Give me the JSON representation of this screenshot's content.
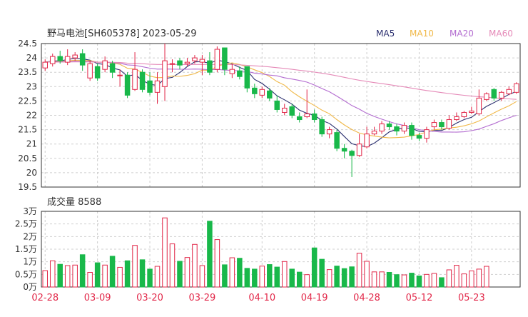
{
  "header": {
    "title": "野马电池[SH605378] 2023-05-29",
    "ma_legend": [
      {
        "label": "MA5",
        "color": "#2b2f6f"
      },
      {
        "label": "MA10",
        "color": "#f0b848"
      },
      {
        "label": "MA20",
        "color": "#b36cd0"
      },
      {
        "label": "MA60",
        "color": "#e58ab8"
      }
    ]
  },
  "colors": {
    "up": "#e2294a",
    "down": "#19b84a",
    "grid": "#cfcfcf",
    "axis": "#333333"
  },
  "chart_data": [
    {
      "type": "candlestick",
      "ylim": [
        19.5,
        24.5
      ],
      "yticks": [
        "24.5",
        "24",
        "23.5",
        "23",
        "22.5",
        "22",
        "21.5",
        "21",
        "20.5",
        "20",
        "19.5"
      ],
      "xticks": [
        {
          "index": 0,
          "label": "02-28"
        },
        {
          "index": 7,
          "label": "03-09"
        },
        {
          "index": 14,
          "label": "03-20"
        },
        {
          "index": 21,
          "label": "03-29"
        },
        {
          "index": 29,
          "label": "04-10"
        },
        {
          "index": 36,
          "label": "04-19"
        },
        {
          "index": 43,
          "label": "04-28"
        },
        {
          "index": 50,
          "label": "05-12"
        },
        {
          "index": 57,
          "label": "05-23"
        }
      ],
      "candles": [
        [
          23.65,
          23.85,
          23.55,
          23.95
        ],
        [
          23.8,
          24.05,
          23.7,
          24.15
        ],
        [
          24.05,
          23.9,
          23.8,
          24.25
        ],
        [
          23.85,
          24.05,
          23.75,
          24.3
        ],
        [
          24.0,
          24.1,
          23.9,
          24.2
        ],
        [
          24.15,
          23.75,
          23.55,
          24.3
        ],
        [
          23.3,
          23.8,
          23.2,
          23.9
        ],
        [
          23.7,
          23.3,
          23.2,
          23.8
        ],
        [
          23.6,
          23.9,
          23.5,
          24.05
        ],
        [
          23.8,
          23.5,
          23.3,
          23.9
        ],
        [
          23.4,
          23.4,
          23.0,
          23.6
        ],
        [
          23.4,
          22.7,
          22.6,
          23.5
        ],
        [
          22.9,
          23.6,
          22.85,
          24.2
        ],
        [
          23.5,
          22.9,
          22.8,
          23.6
        ],
        [
          23.2,
          22.8,
          22.7,
          23.5
        ],
        [
          22.8,
          23.2,
          22.4,
          23.5
        ],
        [
          23.0,
          23.9,
          22.5,
          24.5
        ],
        [
          23.8,
          23.8,
          23.5,
          23.95
        ],
        [
          23.9,
          23.75,
          23.6,
          24.0
        ],
        [
          23.8,
          23.85,
          23.7,
          24.0
        ],
        [
          23.9,
          24.0,
          23.8,
          24.1
        ],
        [
          23.85,
          23.95,
          23.4,
          24.1
        ],
        [
          23.9,
          23.5,
          23.4,
          24.2
        ],
        [
          23.6,
          24.3,
          23.5,
          24.4
        ],
        [
          24.35,
          23.6,
          23.4,
          24.35
        ],
        [
          23.45,
          23.6,
          23.3,
          23.8
        ],
        [
          23.55,
          23.35,
          23.25,
          23.7
        ],
        [
          23.7,
          22.95,
          22.8,
          23.7
        ],
        [
          22.95,
          22.75,
          22.6,
          23.1
        ],
        [
          22.7,
          22.9,
          22.6,
          23.0
        ],
        [
          22.85,
          22.6,
          22.5,
          22.95
        ],
        [
          22.5,
          22.2,
          22.1,
          22.7
        ],
        [
          22.1,
          22.25,
          22.0,
          22.4
        ],
        [
          22.3,
          22.0,
          21.9,
          22.4
        ],
        [
          21.95,
          21.85,
          21.75,
          22.1
        ],
        [
          21.95,
          22.05,
          21.9,
          22.9
        ],
        [
          22.05,
          21.85,
          21.75,
          22.2
        ],
        [
          21.85,
          21.35,
          21.25,
          21.95
        ],
        [
          21.35,
          21.5,
          21.2,
          21.6
        ],
        [
          21.4,
          20.85,
          20.75,
          21.5
        ],
        [
          20.85,
          20.75,
          20.5,
          21.0
        ],
        [
          20.75,
          20.6,
          19.85,
          20.8
        ],
        [
          20.6,
          21.0,
          20.55,
          21.35
        ],
        [
          20.9,
          21.35,
          20.85,
          21.6
        ],
        [
          21.35,
          21.45,
          21.3,
          21.6
        ],
        [
          21.45,
          21.7,
          21.35,
          21.8
        ],
        [
          21.7,
          21.6,
          21.5,
          21.8
        ],
        [
          21.6,
          21.45,
          21.3,
          21.7
        ],
        [
          21.45,
          21.65,
          21.35,
          21.75
        ],
        [
          21.65,
          21.3,
          21.15,
          21.75
        ],
        [
          21.3,
          21.2,
          21.1,
          21.4
        ],
        [
          21.2,
          21.5,
          21.05,
          21.6
        ],
        [
          21.6,
          21.75,
          21.5,
          21.85
        ],
        [
          21.75,
          21.6,
          21.5,
          21.85
        ],
        [
          21.55,
          21.85,
          21.5,
          22.0
        ],
        [
          21.85,
          21.95,
          21.8,
          22.1
        ],
        [
          21.95,
          22.1,
          21.9,
          22.15
        ],
        [
          22.1,
          22.15,
          22.05,
          22.3
        ],
        [
          22.05,
          22.6,
          22.0,
          22.9
        ],
        [
          22.55,
          22.75,
          22.5,
          22.8
        ],
        [
          22.9,
          22.6,
          22.5,
          22.95
        ],
        [
          22.6,
          22.8,
          22.5,
          22.85
        ],
        [
          22.75,
          22.9,
          22.7,
          23.0
        ],
        [
          22.8,
          23.1,
          22.75,
          23.15
        ]
      ]
    },
    {
      "type": "bar",
      "title": "成交量 8588",
      "ylim": [
        0,
        30000
      ],
      "yticks": [
        {
          "value": 30000,
          "label": "3万"
        },
        {
          "value": 25000,
          "label": "2.5万"
        },
        {
          "value": 20000,
          "label": "2万"
        },
        {
          "value": 15000,
          "label": "1.5万"
        },
        {
          "value": 10000,
          "label": "1万"
        },
        {
          "value": 5000,
          "label": "0.5万"
        },
        {
          "value": 0,
          "label": "0万"
        }
      ],
      "values": [
        6500,
        10400,
        9000,
        8500,
        8700,
        12800,
        5800,
        9600,
        8700,
        12200,
        7800,
        10400,
        16500,
        10800,
        7100,
        8200,
        27400,
        17100,
        10200,
        11700,
        16900,
        8500,
        26100,
        18800,
        8800,
        11600,
        11400,
        7400,
        7100,
        8300,
        8900,
        7900,
        10100,
        7100,
        5900,
        4900,
        15500,
        11000,
        6900,
        8300,
        7300,
        8000,
        13400,
        10200,
        6000,
        6000,
        5800,
        4900,
        4800,
        5500,
        4400,
        5000,
        5400,
        3700,
        6800,
        8600,
        5200,
        6400,
        7100,
        8200
      ]
    }
  ]
}
